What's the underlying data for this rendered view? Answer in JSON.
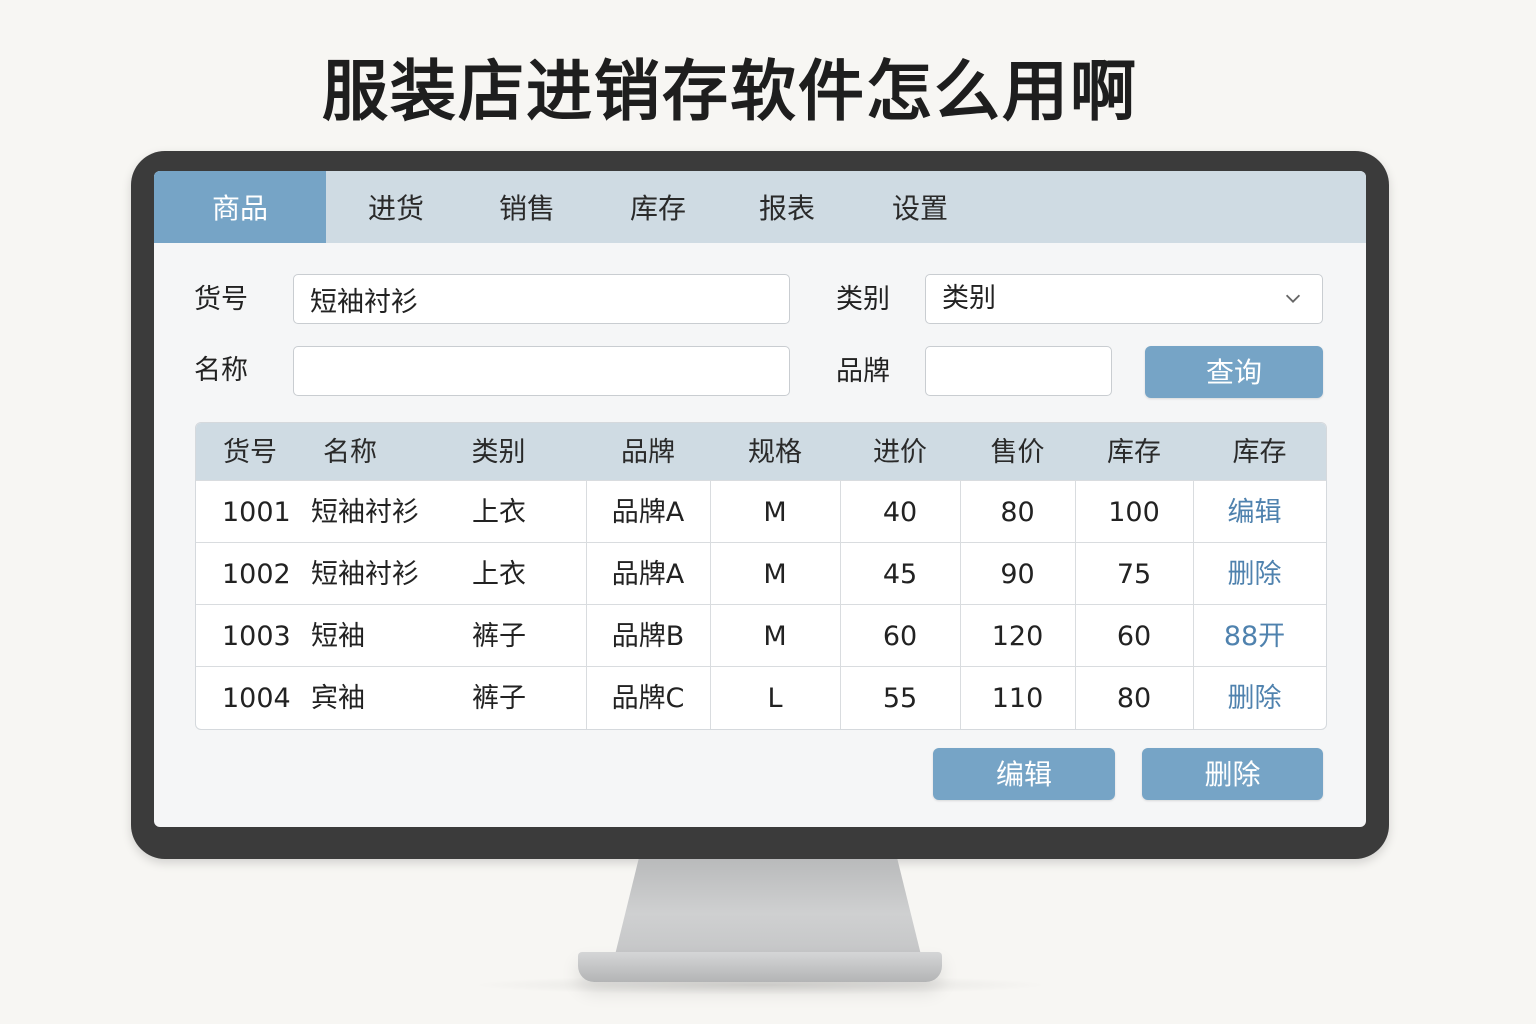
{
  "headline": "服装店进销存软件怎么用啊",
  "tabs": [
    {
      "label": "商品",
      "active": true
    },
    {
      "label": "进货",
      "active": false
    },
    {
      "label": "销售",
      "active": false
    },
    {
      "label": "库存",
      "active": false
    },
    {
      "label": "报表",
      "active": false
    },
    {
      "label": "设置",
      "active": false
    }
  ],
  "form": {
    "code_label": "货号",
    "code_value": "短袖衬衫",
    "category_label": "类别",
    "category_value": "类别",
    "name_label": "名称",
    "name_value": "",
    "brand_label": "品牌",
    "brand_value": "",
    "query_button": "查询"
  },
  "table": {
    "columns": [
      "货号",
      "名称",
      "类别",
      "品牌",
      "规格",
      "进价",
      "售价",
      "库存",
      "库存"
    ],
    "rows": [
      [
        "1001",
        "短袖衬衫",
        "上衣",
        "品牌A",
        "M",
        "40",
        "80",
        "100",
        "编辑"
      ],
      [
        "1002",
        "短袖衬衫",
        "上衣",
        "品牌A",
        "M",
        "45",
        "90",
        "75",
        "删除"
      ],
      [
        "1003",
        "短袖",
        "裤子",
        "品牌B",
        "M",
        "60",
        "120",
        "60",
        "88开"
      ],
      [
        "1004",
        "宾袖",
        "裤子",
        "品牌C",
        "L",
        "55",
        "110",
        "80",
        "删除"
      ]
    ]
  },
  "actions": {
    "edit_button": "编辑",
    "delete_button": "删除"
  },
  "colors": {
    "accent": "#76a4c6",
    "header_bg": "#cfdbe3",
    "action_link": "#4f82ae",
    "bezel": "#3b3b3b"
  },
  "icons": {
    "category_select": "chevron-down-icon"
  }
}
